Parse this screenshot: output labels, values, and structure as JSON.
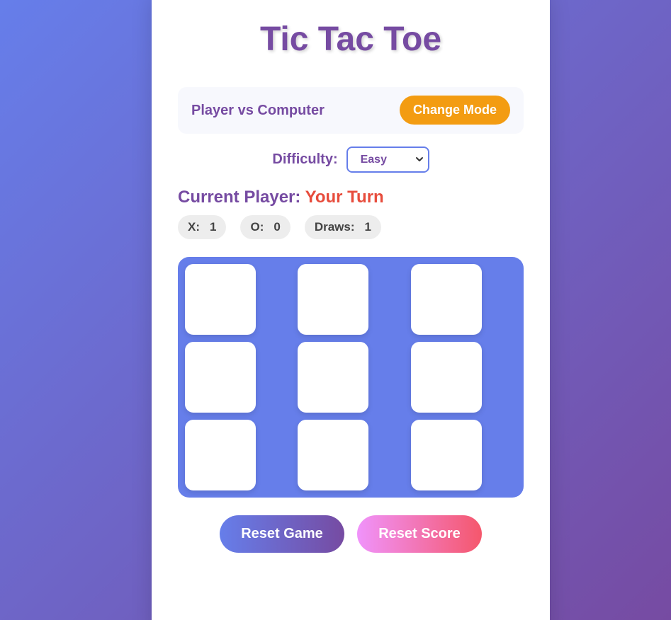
{
  "title": "Tic Tac Toe",
  "mode": {
    "label": "Player vs Computer",
    "button_label": "Change Mode"
  },
  "difficulty": {
    "label": "Difficulty:",
    "selected": "Easy"
  },
  "status": {
    "prefix": "Current Player:",
    "turn": "Your Turn"
  },
  "scores": {
    "x_label": "X:",
    "x_value": "1",
    "o_label": "O:",
    "o_value": "0",
    "draws_label": "Draws:",
    "draws_value": "1"
  },
  "board": {
    "cells": [
      "",
      "",
      "",
      "",
      "",
      "",
      "",
      "",
      ""
    ]
  },
  "actions": {
    "reset_game": "Reset Game",
    "reset_score": "Reset Score"
  },
  "colors": {
    "primary": "#764ba2",
    "accent": "#667eea",
    "mode_button": "#f39c12",
    "turn": "#e74c3c"
  }
}
